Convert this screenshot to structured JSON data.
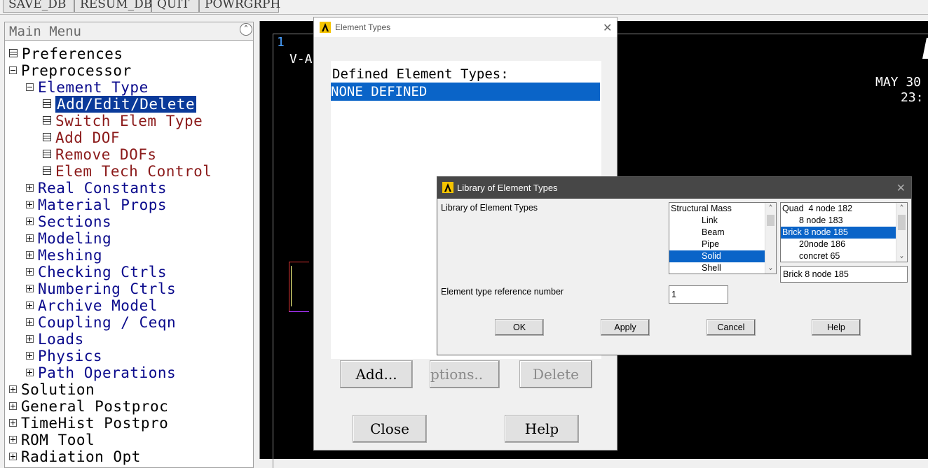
{
  "toolbar": {
    "buttons": [
      "SAVE_DB",
      "RESUM_DB",
      "QUIT",
      "POWRGRPH"
    ]
  },
  "main_menu": {
    "title": "Main Menu",
    "items": [
      {
        "label": "Preferences",
        "expander": "box"
      },
      {
        "label": "Preprocessor",
        "expander": "minus"
      },
      {
        "label": "Element Type",
        "expander": "minus"
      },
      {
        "label": "Add/Edit/Delete",
        "expander": "box",
        "selected": true
      },
      {
        "label": "Switch Elem Type",
        "expander": "box"
      },
      {
        "label": "Add DOF",
        "expander": "box"
      },
      {
        "label": "Remove DOFs",
        "expander": "box"
      },
      {
        "label": "Elem Tech Control",
        "expander": "box"
      },
      {
        "label": "Real Constants",
        "expander": "plus"
      },
      {
        "label": "Material Props",
        "expander": "plus"
      },
      {
        "label": "Sections",
        "expander": "plus"
      },
      {
        "label": "Modeling",
        "expander": "plus"
      },
      {
        "label": "Meshing",
        "expander": "plus"
      },
      {
        "label": "Checking Ctrls",
        "expander": "plus"
      },
      {
        "label": "Numbering Ctrls",
        "expander": "plus"
      },
      {
        "label": "Archive Model",
        "expander": "plus"
      },
      {
        "label": "Coupling / Ceqn",
        "expander": "plus"
      },
      {
        "label": "Loads",
        "expander": "plus"
      },
      {
        "label": "Physics",
        "expander": "plus"
      },
      {
        "label": "Path Operations",
        "expander": "plus"
      },
      {
        "label": "Solution",
        "expander": "plus"
      },
      {
        "label": "General Postproc",
        "expander": "plus"
      },
      {
        "label": "TimeHist Postpro",
        "expander": "plus"
      },
      {
        "label": "ROM Tool",
        "expander": "plus"
      },
      {
        "label": "Radiation Opt",
        "expander": "plus"
      }
    ]
  },
  "graphics": {
    "window_number": "1",
    "line2": "V-A",
    "date": "MAY 30",
    "time": "23:"
  },
  "element_types_dialog": {
    "title": "Element Types",
    "heading": "Defined Element Types:",
    "entries": [
      "NONE DEFINED"
    ],
    "buttons": {
      "add": "Add...",
      "options": "ptions..",
      "delete": "Delete",
      "close": "Close",
      "help": "Help"
    }
  },
  "library_dialog": {
    "title": "Library of Element Types",
    "library_label": "Library of Element Types",
    "category_list": [
      "Structural Mass",
      "Link",
      "Beam",
      "Pipe",
      "Solid",
      "Shell"
    ],
    "category_selected": "Solid",
    "type_list": [
      "Quad  4 node 182",
      "8 node 183",
      "Brick 8 node 185",
      "20node 186",
      "concret 65"
    ],
    "type_selected": "Brick 8 node 185",
    "type_field_value": "Brick 8 node 185",
    "ref_label": "Element type reference number",
    "ref_value": "1",
    "buttons": {
      "ok": "OK",
      "apply": "Apply",
      "cancel": "Cancel",
      "help": "Help"
    }
  },
  "colors": {
    "selection_blue": "#0a64c8",
    "tree_navy": "#0a0a8c",
    "tree_maroon": "#8b1a1a",
    "graphics_bg": "#000000"
  }
}
